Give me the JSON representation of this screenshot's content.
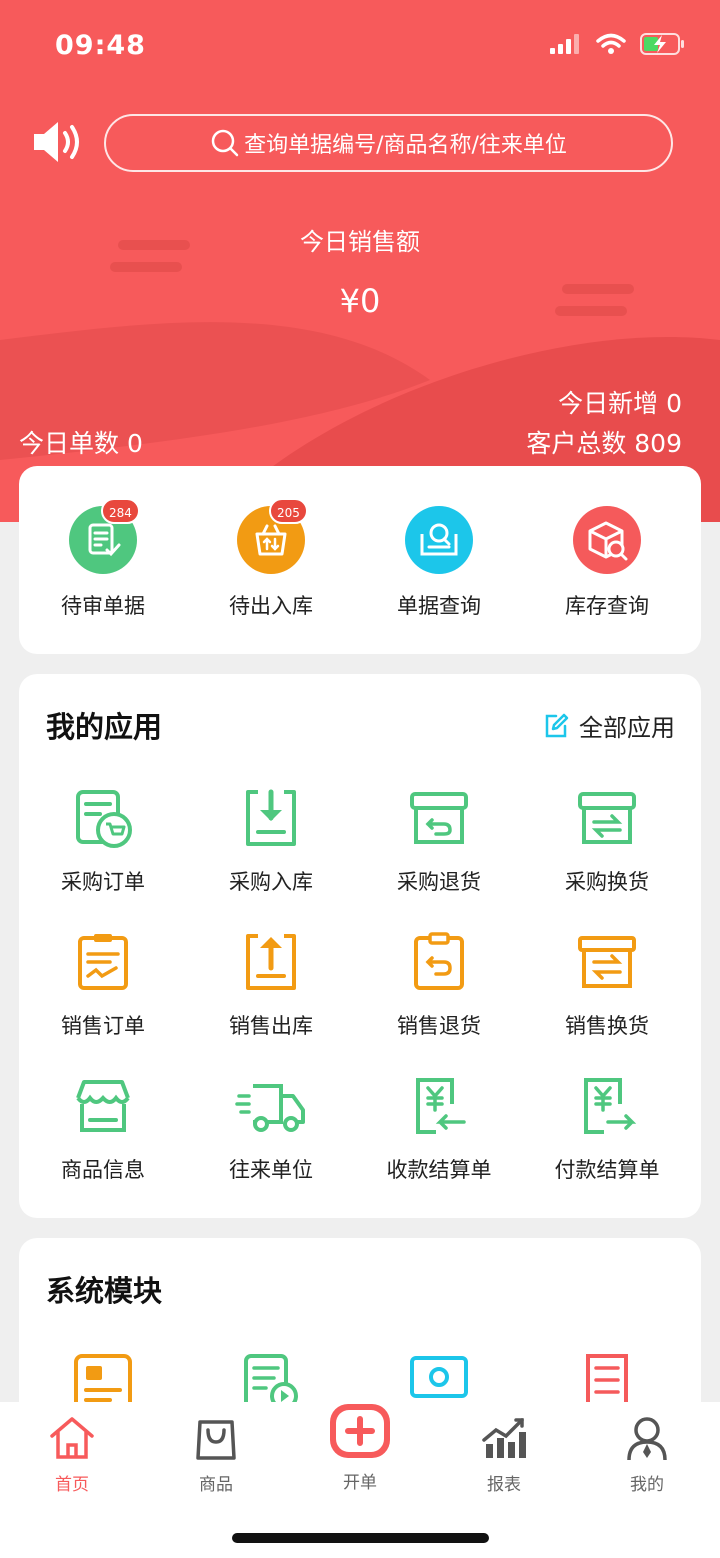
{
  "status_bar": {
    "time": "09:48"
  },
  "search": {
    "placeholder": "查询单据编号/商品名称/往来单位"
  },
  "summary": {
    "sales_title": "今日销售额",
    "sales_amount": "¥0",
    "orders_today": "今日单数 0",
    "new_today": "今日新增 0",
    "customers_total": "客户总数 809"
  },
  "quick_actions": [
    {
      "label": "待审单据",
      "badge": "284",
      "color": "#4fc77f",
      "icon": "pending-review-icon"
    },
    {
      "label": "待出入库",
      "badge": "205",
      "color": "#f29b13",
      "icon": "stock-pending-icon"
    },
    {
      "label": "单据查询",
      "badge": "",
      "color": "#1cc6ea",
      "icon": "document-search-icon"
    },
    {
      "label": "库存查询",
      "badge": "",
      "color": "#f55a5b",
      "icon": "inventory-search-icon"
    }
  ],
  "my_apps": {
    "title": "我的应用",
    "all_label": "全部应用",
    "items": [
      {
        "label": "采购订单",
        "icon": "purchase-order-icon",
        "color": "#4fc77f"
      },
      {
        "label": "采购入库",
        "icon": "purchase-inbound-icon",
        "color": "#4fc77f"
      },
      {
        "label": "采购退货",
        "icon": "purchase-return-icon",
        "color": "#4fc77f"
      },
      {
        "label": "采购换货",
        "icon": "purchase-exchange-icon",
        "color": "#4fc77f"
      },
      {
        "label": "销售订单",
        "icon": "sales-order-icon",
        "color": "#f29b13"
      },
      {
        "label": "销售出库",
        "icon": "sales-outbound-icon",
        "color": "#f29b13"
      },
      {
        "label": "销售退货",
        "icon": "sales-return-icon",
        "color": "#f29b13"
      },
      {
        "label": "销售换货",
        "icon": "sales-exchange-icon",
        "color": "#f29b13"
      },
      {
        "label": "商品信息",
        "icon": "product-info-icon",
        "color": "#4fc77f"
      },
      {
        "label": "往来单位",
        "icon": "partner-icon",
        "color": "#4fc77f"
      },
      {
        "label": "收款结算单",
        "icon": "receipt-settlement-icon",
        "color": "#4fc77f"
      },
      {
        "label": "付款结算单",
        "icon": "payment-settlement-icon",
        "color": "#4fc77f"
      }
    ]
  },
  "system_modules": {
    "title": "系统模块",
    "items": [
      {
        "icon": "profile-card-icon",
        "color": "#f29b13"
      },
      {
        "icon": "video-doc-icon",
        "color": "#4fc77f"
      },
      {
        "icon": "settings-monitor-icon",
        "color": "#1cc6ea"
      },
      {
        "icon": "list-doc-icon",
        "color": "#f55a5b"
      }
    ]
  },
  "nav": [
    {
      "label": "首页",
      "icon": "home-icon",
      "active": true
    },
    {
      "label": "商品",
      "icon": "bag-icon",
      "active": false
    },
    {
      "label": "开单",
      "icon": "add-order-icon",
      "active": false
    },
    {
      "label": "报表",
      "icon": "chart-icon",
      "active": false
    },
    {
      "label": "我的",
      "icon": "user-icon",
      "active": false
    }
  ]
}
